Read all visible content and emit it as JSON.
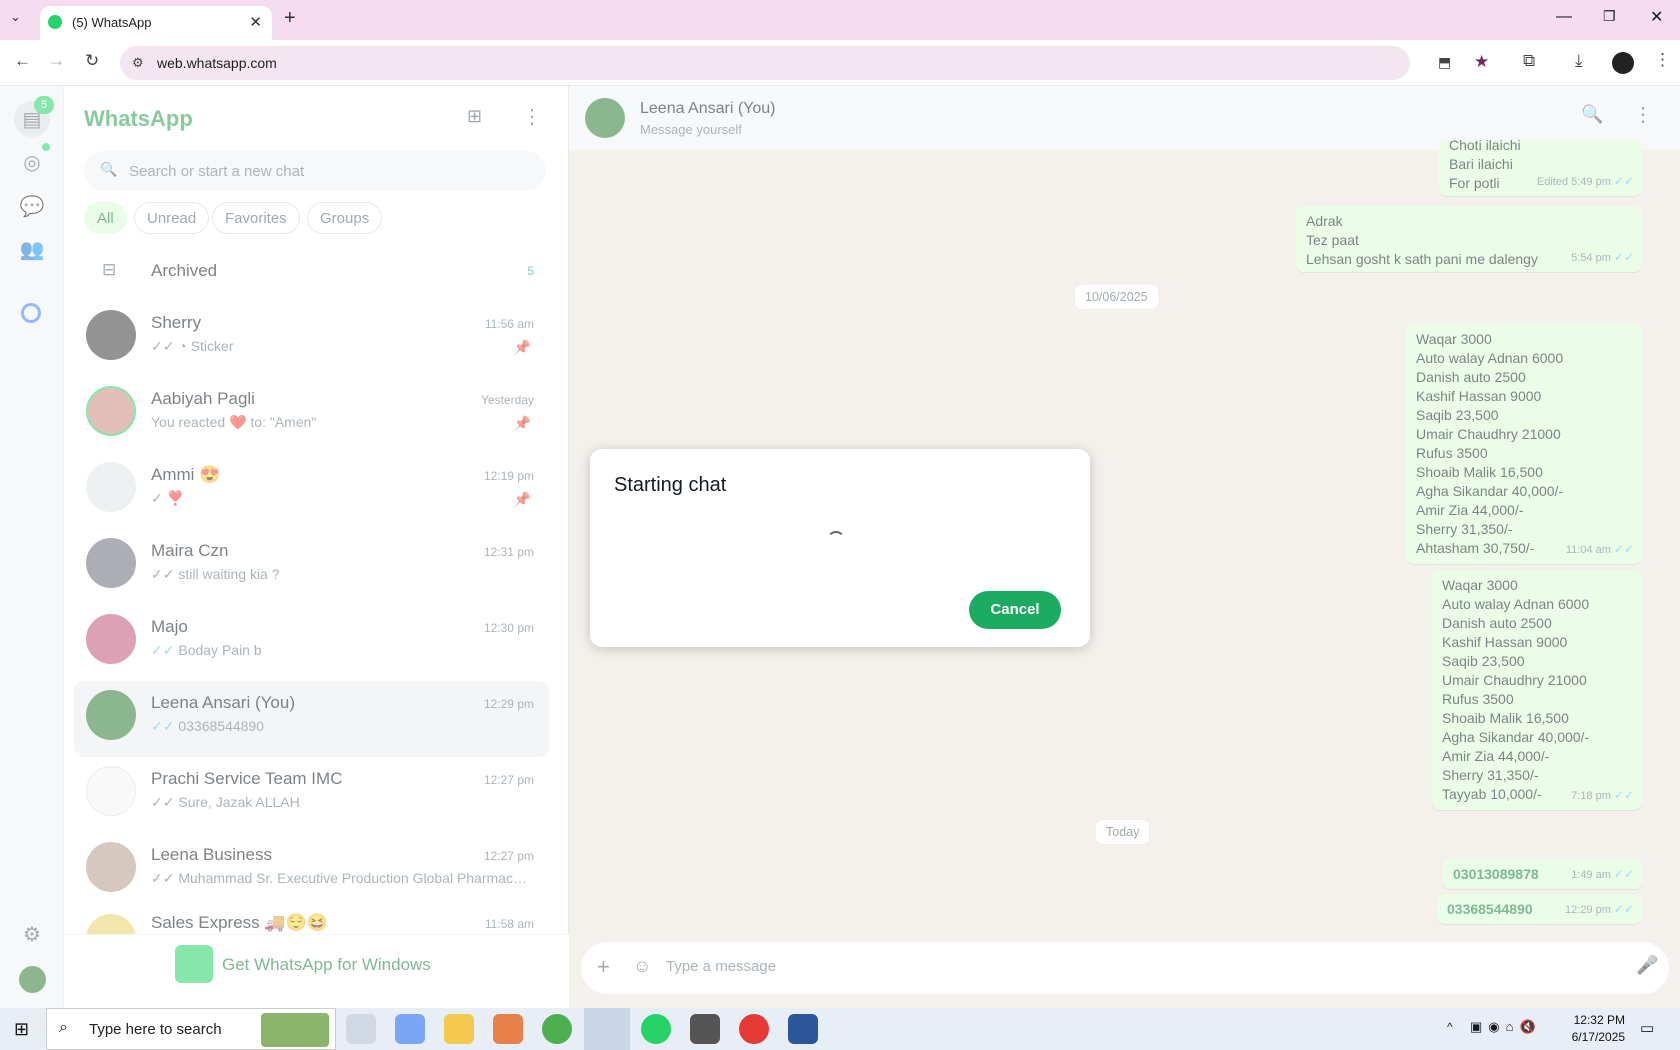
{
  "browser": {
    "tab_title": "(5) WhatsApp",
    "new_tab": "+",
    "url": "web.whatsapp.com"
  },
  "rail": {
    "chats_badge": "5"
  },
  "sidebar": {
    "title": "WhatsApp",
    "search_placeholder": "Search or start a new chat",
    "filters": [
      "All",
      "Unread",
      "Favorites",
      "Groups"
    ],
    "archived_label": "Archived",
    "archived_count": "5",
    "chats": [
      {
        "name": "Sherry",
        "preview": "Sticker",
        "time": "11:56 am",
        "pinned": true
      },
      {
        "name": "Aabiyah Pagli",
        "preview": "You reacted ❤️ to: \"Amen\"",
        "time": "Yesterday",
        "pinned": true
      },
      {
        "name": "Ammi 😍",
        "preview": "❣️",
        "time": "12:19 pm",
        "pinned": true
      },
      {
        "name": "Maira Czn",
        "preview": "still waiting kia ?",
        "time": "12:31 pm",
        "pinned": false
      },
      {
        "name": "Majo",
        "preview": "Boday Pain b",
        "time": "12:30 pm",
        "pinned": false
      },
      {
        "name": "Leena Ansari (You)",
        "preview": "03368544890",
        "time": "12:29 pm",
        "pinned": false
      },
      {
        "name": "Prachi Service Team IMC",
        "preview": "Sure, Jazak ALLAH",
        "time": "12:27 pm",
        "pinned": false
      },
      {
        "name": "Leena Business",
        "preview": "Muhammad Sr. Executive Production Global Pharmaceu...",
        "time": "12:27 pm",
        "pinned": false
      },
      {
        "name": "Sales Express 🚚😌😆",
        "preview": "",
        "time": "11:58 am",
        "pinned": false
      }
    ],
    "get_app": "Get WhatsApp for Windows"
  },
  "chat": {
    "name": "Leena Ansari (You)",
    "subtitle": "Message yourself",
    "messages": [
      {
        "lines": [
          "Choti ilaichi",
          "Bari ilaichi",
          "For potli"
        ],
        "meta": "Edited 5:49 pm"
      },
      {
        "lines": [
          "Adrak",
          "Tez paat",
          "Lehsan gosht k sath pani me dalengy"
        ],
        "meta": "5:54 pm"
      },
      {
        "lines": [
          "Waqar 3000",
          "Auto walay Adnan 6000",
          "Danish auto 2500",
          "Kashif Hassan 9000",
          "Saqib 23,500",
          "Umair Chaudhry 21000",
          "Rufus 3500",
          "Shoaib Malik 16,500",
          "Agha Sikandar 40,000/-",
          "Amir Zia 44,000/-",
          "Sherry 31,350/-",
          "Ahtasham 30,750/-"
        ],
        "meta": "11:04 am"
      },
      {
        "lines": [
          "Waqar 3000",
          "Auto walay Adnan 6000",
          "Danish auto 2500",
          "Kashif Hassan 9000",
          "Saqib 23,500",
          "Umair Chaudhry 21000",
          "Rufus 3500",
          "Shoaib Malik 16,500",
          "Agha Sikandar 40,000/-",
          "Amir Zia 44,000/-",
          "Sherry 31,350/-",
          "Tayyab 10,000/-"
        ],
        "meta": "7:18 pm"
      },
      {
        "lines": [
          "03013089878"
        ],
        "meta": "1:49 am"
      },
      {
        "lines": [
          "03368544890"
        ],
        "meta": "12:29 pm"
      }
    ],
    "date_1": "10/06/2025",
    "date_2": "Today",
    "composer_placeholder": "Type a message"
  },
  "dialog": {
    "title": "Starting chat",
    "cancel": "Cancel"
  },
  "taskbar": {
    "search_placeholder": "Type here to search",
    "time": "12:32 PM",
    "date": "6/17/2025"
  },
  "colors": {
    "brand": "#25a04e",
    "bubble": "#d9fdd3",
    "button": "#1daa61"
  }
}
